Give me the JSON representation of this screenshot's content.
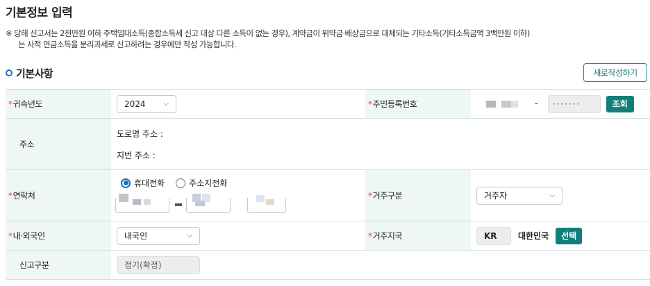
{
  "page": {
    "title": "기본정보 입력",
    "notice_line1": "※ 당해 신고서는 2천만원 이하 주택임대소득(종합소득세 신고 대상 다른 소득이 없는 경우), 계약금이 위약금·배상금으로 대체되는 기타소득(기타소득금액 3백만원 이하)",
    "notice_line2": "는 사적 연금소득을 분리과세로 신고하려는 경우에만 작성 가능합니다."
  },
  "section": {
    "title": "기본사항",
    "new_button": "새로작성하기"
  },
  "form": {
    "year_label": "귀속년도",
    "year_value": "2024",
    "rrn_label": "주민등록번호",
    "rrn_masked": "·······",
    "rrn_dash": "-",
    "lookup_button": "조회",
    "address_label": "주소",
    "road_address_label": "도로명 주소 :",
    "lot_address_label": "지번 주소 :",
    "contact_label": "연락처",
    "radio_mobile": "휴대전화",
    "radio_home": "주소지전화",
    "phone_dash": "-",
    "residence_label": "거주구분",
    "residence_value": "거주자",
    "nationality_label": "내·외국인",
    "nationality_value": "내국인",
    "country_label": "거주지국",
    "country_code": "KR",
    "country_name": "대한민국",
    "select_button": "선택",
    "report_type_label": "신고구분",
    "report_type_value": "정기(확정)"
  },
  "icons": {
    "section_bullet": "circle-bullet-icon",
    "dropdown": "chevron-down-icon",
    "required": "required-asterisk-icon"
  },
  "colors": {
    "accent_teal": "#127e79",
    "label_bg": "#eef6f6",
    "required": "#e0433a",
    "radio_selected": "#1a6fc4"
  }
}
